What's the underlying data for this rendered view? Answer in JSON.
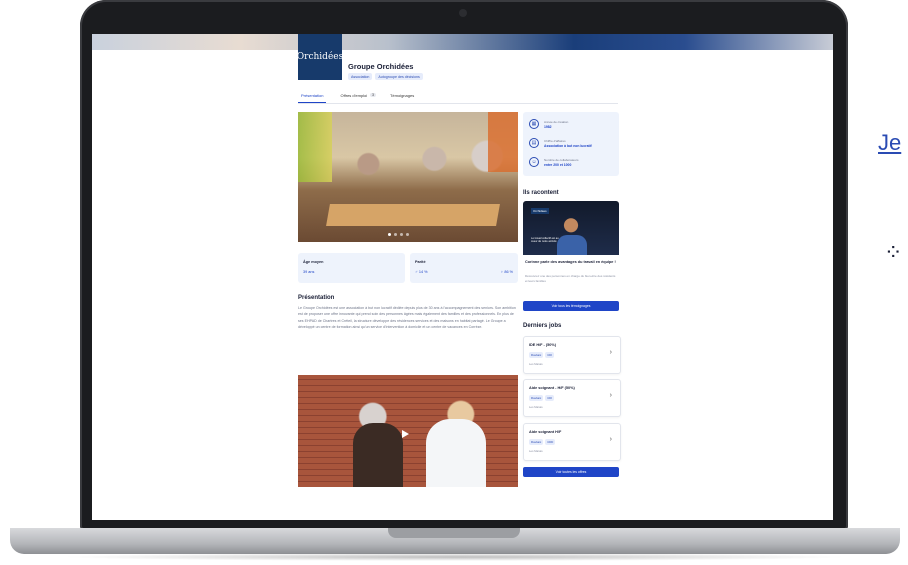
{
  "org": {
    "logo_text": "Orchidées",
    "name": "Groupe Orchidées",
    "chips": [
      "Association",
      "Autogroupe des décisions"
    ]
  },
  "tabs": [
    {
      "label": "Présentation"
    },
    {
      "label": "Offres d'emploi",
      "count": "3"
    },
    {
      "label": "Témoignages"
    }
  ],
  "info": [
    {
      "icon": "calendar-icon",
      "label": "Année de création",
      "value": "1982"
    },
    {
      "icon": "building-icon",
      "label": "Chiffre d'affaires",
      "value": "Association à but non lucratif"
    },
    {
      "icon": "people-icon",
      "label": "Nombre de collaborateurs",
      "value": "entre 200 et 1000"
    }
  ],
  "stats": {
    "age_label": "Âge moyen",
    "age_value": "39 ans",
    "parity_label": "Parité",
    "parity_men": "♂ 14 %",
    "parity_women": "♀ 86 %"
  },
  "presentation": {
    "heading": "Présentation",
    "text": "Le Groupe Orchidées est une association à but non lucratif dédiée depuis plus de 30 ans à l'accompagnement des seniors. Son ambition est de proposer une offre innovante qui prend soin des personnes âgées mais également des familles et des professionnels. En plus de ses EHPAD de Chartres et Créteil, la structure développe des résidences services et des maisons en habitat partagé. Le Groupe a développé un centre de formation ainsi qu'un service d'intervention à domicile et un centre de vacances en Corrèze."
  },
  "stories": {
    "heading": "Ils racontent",
    "video_tag": "Orchidées",
    "video_caption": "Le travail collectif est au coeur de notre activité",
    "title": "Corinne parle des avantages du travail en équipe !",
    "desc": "Découvrez une des personnes en charge du bien-être des résidents et leurs familles",
    "button": "Voir tous les témoignages"
  },
  "jobs": {
    "heading": "Derniers jobs",
    "items": [
      {
        "title": "IDE H/F - (50%)",
        "chips": [
          "Roubaix",
          "CDI"
        ],
        "loc": "Les Marais"
      },
      {
        "title": "Aide soignant - H/F (50%)",
        "chips": [
          "Roubaix",
          "CDI"
        ],
        "loc": "Les Marais"
      },
      {
        "title": "Aide soignant H/F",
        "chips": [
          "Roubaix",
          "CDD"
        ],
        "loc": "Les Marais"
      }
    ],
    "button": "Voir toutes les offres"
  },
  "outside": {
    "text_a": "Je",
    "text_b": "⁘"
  }
}
